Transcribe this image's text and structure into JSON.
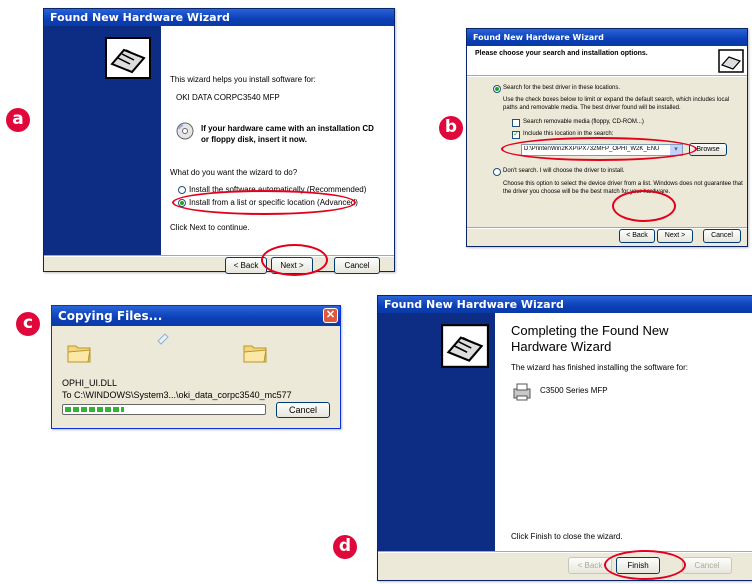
{
  "badges": {
    "a": "a",
    "b": "b",
    "c": "c",
    "d": "d"
  },
  "panel_a": {
    "title": "Found New Hardware Wizard",
    "intro": "This wizard helps you install software for:",
    "device": "OKI DATA CORPC3540 MFP",
    "cd_hint_line1": "If your hardware came with an installation CD",
    "cd_hint_line2": "or floppy disk, insert it now.",
    "question": "What do you want the wizard to do?",
    "option_auto": "Install the software automatically (Recommended)",
    "option_list": "Install from a list or specific location (Advanced)",
    "continue_hint": "Click Next to continue.",
    "back_label": "< Back",
    "next_label": "Next >",
    "cancel_label": "Cancel"
  },
  "panel_b": {
    "title": "Found New Hardware Wizard",
    "heading": "Please choose your search and installation options.",
    "option_search": "Search for the best driver in these locations.",
    "search_desc_line1": "Use the check boxes below to limit or expand the default search, which includes local",
    "search_desc_line2": "paths and removable media. The best driver found will be installed.",
    "check_removable": "Search removable media (floppy, CD-ROM...)",
    "check_include": "Include this location in the search:",
    "path_value": "D:\\Printer\\Win2KXP\\PX732MFP_OPHI_W2K_ENU",
    "browse_label": "Browse",
    "option_dont_search": "Don't search. I will choose the driver to install.",
    "dont_desc_line1": "Choose this option to select the device driver from a list.  Windows does not guarantee that",
    "dont_desc_line2": "the driver you choose will be the best match for your hardware.",
    "back_label": "< Back",
    "next_label": "Next >",
    "cancel_label": "Cancel"
  },
  "panel_c": {
    "title": "Copying Files...",
    "file_name": "OPHI_UI.DLL",
    "destination": "To C:\\WINDOWS\\System3...\\oki_data_corpc3540_mc577",
    "progress_fraction": 0.3,
    "cancel_label": "Cancel"
  },
  "panel_d": {
    "title": "Found New Hardware Wizard",
    "heading_line1": "Completing the Found New",
    "heading_line2": "Hardware Wizard",
    "finished_text": "The wizard has finished installing the software for:",
    "device": "C3500 Series MFP",
    "close_hint": "Click Finish to close the wizard.",
    "back_label": "< Back",
    "finish_label": "Finish",
    "cancel_label": "Cancel"
  },
  "colors": {
    "xp_blue": "#0a3aa6",
    "highlight_red": "#e3001b",
    "badge": "#e0073a",
    "progress_green": "#33b533"
  }
}
